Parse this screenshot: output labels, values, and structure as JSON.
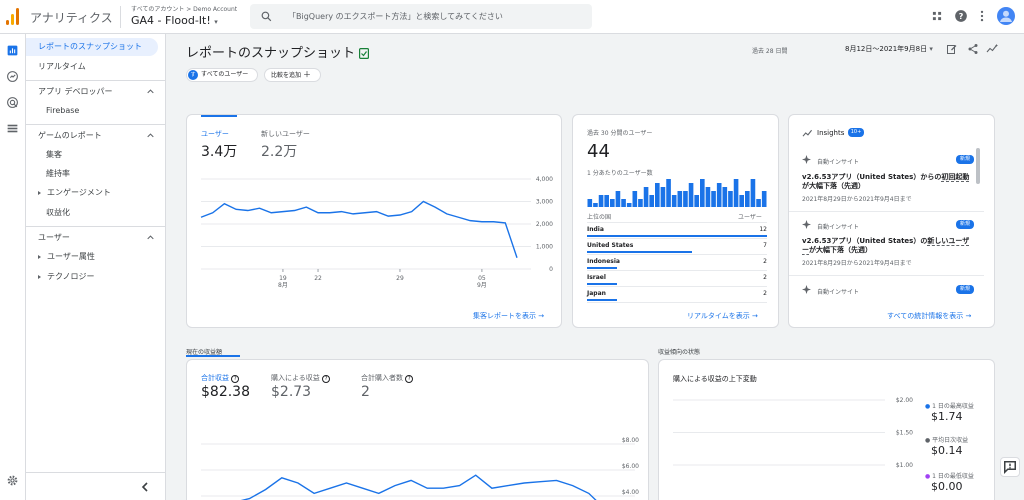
{
  "header": {
    "product": "アナリティクス",
    "account_path": "すべてのアカウント > Demo Account",
    "property_name": "GA4 - Flood-It!",
    "search_placeholder": "「BigQuery のエクスポート方法」と検索してみてください"
  },
  "nav": {
    "snapshot": "レポートのスナップショット",
    "realtime": "リアルタイム",
    "app_dev": "アプリ デベロッパー",
    "firebase": "Firebase",
    "game_reports": "ゲームのレポート",
    "acquisition": "集客",
    "retention": "維持率",
    "engagement": "エンゲージメント",
    "monetization": "収益化",
    "user": "ユーザー",
    "user_attr": "ユーザー属性",
    "tech": "テクノロジー"
  },
  "page": {
    "title": "レポートのスナップショット",
    "date_prefix": "過去 28 日間",
    "date_range": "8月12日～2021年9月8日",
    "segment_chip": "すべてのユーザー",
    "segment_letter": "す",
    "compare_chip": "比較を追加"
  },
  "users_card": {
    "tab1_label": "ユーザー",
    "tab1_value": "3.4万",
    "tab2_label": "新しいユーザー",
    "tab2_value": "2.2万",
    "link": "集客レポートを表示"
  },
  "realtime_card": {
    "heading": "過去 30 分間のユーザー",
    "value": "44",
    "per_minute": "1 分あたりのユーザー数",
    "col_country": "上位の国",
    "col_users": "ユーザー",
    "link": "リアルタイムを表示"
  },
  "insights_card": {
    "title": "Insights",
    "badge": "10+",
    "item_label": "自動インサイト",
    "new_badge": "新規",
    "item1_text_a": "v2.6.53アプリ（United States）からの",
    "item1_text_b": "初回起動",
    "item1_text_c": "が大幅下落（先週）",
    "item1_date": "2021年8月29日から2021年9月4日まで",
    "item2_text_a": "v2.6.53アプリ（United States）の",
    "item2_text_b": "新しいユーザー",
    "item2_text_c": "が大幅下落（先週）",
    "item2_date": "2021年8月29日から2021年9月4日まで",
    "link": "すべての統計情報を表示"
  },
  "revenue_section": {
    "label": "現在の収益額",
    "tab1_label": "合計収益",
    "tab1_value": "$82.38",
    "tab2_label": "購入による収益",
    "tab2_value": "$2.73",
    "tab3_label": "合計購入者数",
    "tab3_value": "2"
  },
  "trend_section": {
    "label": "収益傾向の状態",
    "card_title": "購入による収益の上下変動",
    "max_label": "1 日の最高収益",
    "max_value": "$1.74",
    "avg_label": "平均日次収益",
    "avg_value": "$0.14",
    "min_label": "1 日の最低収益",
    "min_value": "$0.00"
  },
  "chart_data": [
    {
      "type": "line",
      "title": "",
      "x": [
        "8月12日",
        "8月13日",
        "8月14日",
        "8月15日",
        "8月16日",
        "8月17日",
        "8月18日",
        "8月19日",
        "8月20日",
        "8月21日",
        "8月22日",
        "8月23日",
        "8月24日",
        "8月25日",
        "8月26日",
        "8月27日",
        "8月28日",
        "8月29日",
        "8月30日",
        "8月31日",
        "9月1日",
        "9月2日",
        "9月3日",
        "9月4日",
        "9月5日",
        "9月6日",
        "9月7日",
        "9月8日"
      ],
      "values": [
        2300,
        2500,
        2900,
        2650,
        2600,
        2700,
        2500,
        2550,
        2600,
        2750,
        2500,
        2500,
        2550,
        2450,
        2500,
        2550,
        2350,
        2400,
        2550,
        3000,
        2750,
        2450,
        2300,
        2150,
        2100,
        2100,
        2050,
        500
      ],
      "x_ticks": [
        {
          "label": "19",
          "sub": "8月",
          "index": 7
        },
        {
          "label": "22",
          "index": 10
        },
        {
          "label": "29",
          "index": 17
        },
        {
          "label": "05",
          "sub": "9月",
          "index": 24
        }
      ],
      "y_ticks": [
        "4,000",
        "3,000",
        "2,000",
        "1,000",
        "0"
      ],
      "ylim": [
        0,
        4000
      ]
    },
    {
      "type": "bar",
      "title": "",
      "values": [
        2,
        1,
        3,
        3,
        2,
        4,
        2,
        1,
        4,
        2,
        5,
        3,
        6,
        5,
        7,
        3,
        4,
        4,
        6,
        3,
        7,
        5,
        4,
        6,
        5,
        4,
        7,
        3,
        4,
        7,
        2,
        4
      ],
      "countries": [
        {
          "name": "India",
          "users": 12
        },
        {
          "name": "United States",
          "users": 7
        },
        {
          "name": "Indonesia",
          "users": 2
        },
        {
          "name": "Israel",
          "users": 2
        },
        {
          "name": "Japan",
          "users": 2
        }
      ]
    },
    {
      "type": "line",
      "title": "",
      "values": [
        3.0,
        3.2,
        3.5,
        3.8,
        4.5,
        5.4,
        5.0,
        4.2,
        4.6,
        5.0,
        4.6,
        4.2,
        4.8,
        5.2,
        4.6,
        4.6,
        4.8,
        5.6,
        4.6,
        4.8,
        5.0,
        5.1,
        5.2,
        4.8,
        4.2,
        3.0
      ],
      "y_ticks": [
        "$8.00",
        "$6.00",
        "$4.00"
      ],
      "ylim": [
        0,
        8
      ]
    },
    {
      "type": "line",
      "title": "",
      "y_ticks": [
        "$2.00",
        "$1.50",
        "$1.00"
      ],
      "ylim": [
        0,
        2
      ]
    }
  ]
}
